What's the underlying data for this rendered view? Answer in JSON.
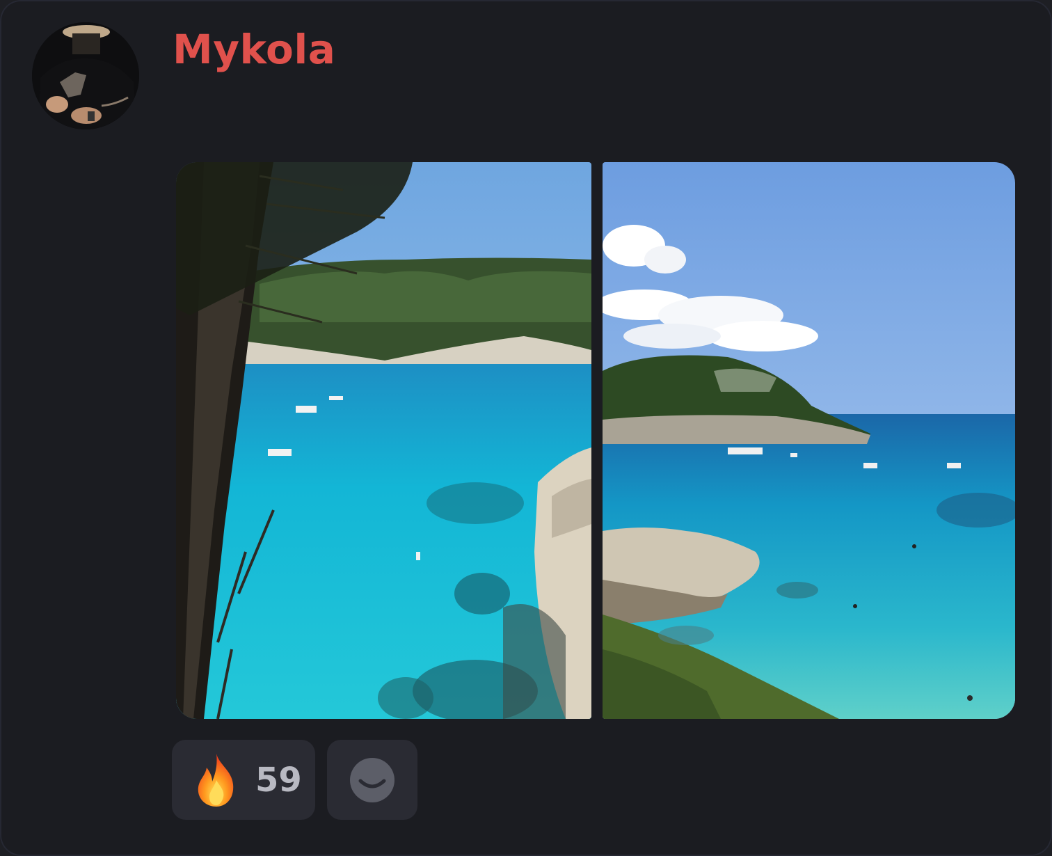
{
  "message": {
    "author": "Mykola",
    "author_color": "#e0514c",
    "avatar_icon": "user-avatar",
    "photos": [
      {
        "subject": "beach-photo-1"
      },
      {
        "subject": "beach-photo-2"
      }
    ]
  },
  "reactions": [
    {
      "icon": "fire-emoji-icon",
      "count": "59"
    },
    {
      "icon": "add-reaction-smile-icon"
    }
  ]
}
